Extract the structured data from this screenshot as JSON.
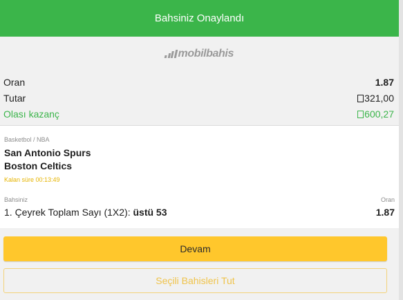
{
  "header": {
    "title": "Bahsiniz Onaylandı"
  },
  "logo": {
    "text": "mobilbahis"
  },
  "summary": {
    "odds_label": "Oran",
    "odds_value": "1.87",
    "stake_label": "Tutar",
    "stake_value": "321,00",
    "win_label": "Olası kazanç",
    "win_value": "600,27"
  },
  "event": {
    "category": "Basketbol / NBA",
    "home_team": "San Antonio Spurs",
    "away_team": "Boston Celtics",
    "time_left": "Kalan süre 00:13:49",
    "bet_label": "Bahsiniz",
    "odds_label": "Oran",
    "market": "1. Çeyrek Toplam Sayı (1X2): ",
    "pick": "üstü 53",
    "odds": "1.87"
  },
  "buttons": {
    "continue": "Devam",
    "keep": "Seçili Bahisleri Tut"
  },
  "colors": {
    "header": "#3bb54a",
    "win": "#3bb54a",
    "primary_button": "#ffc72c",
    "time": "#e6b400"
  }
}
